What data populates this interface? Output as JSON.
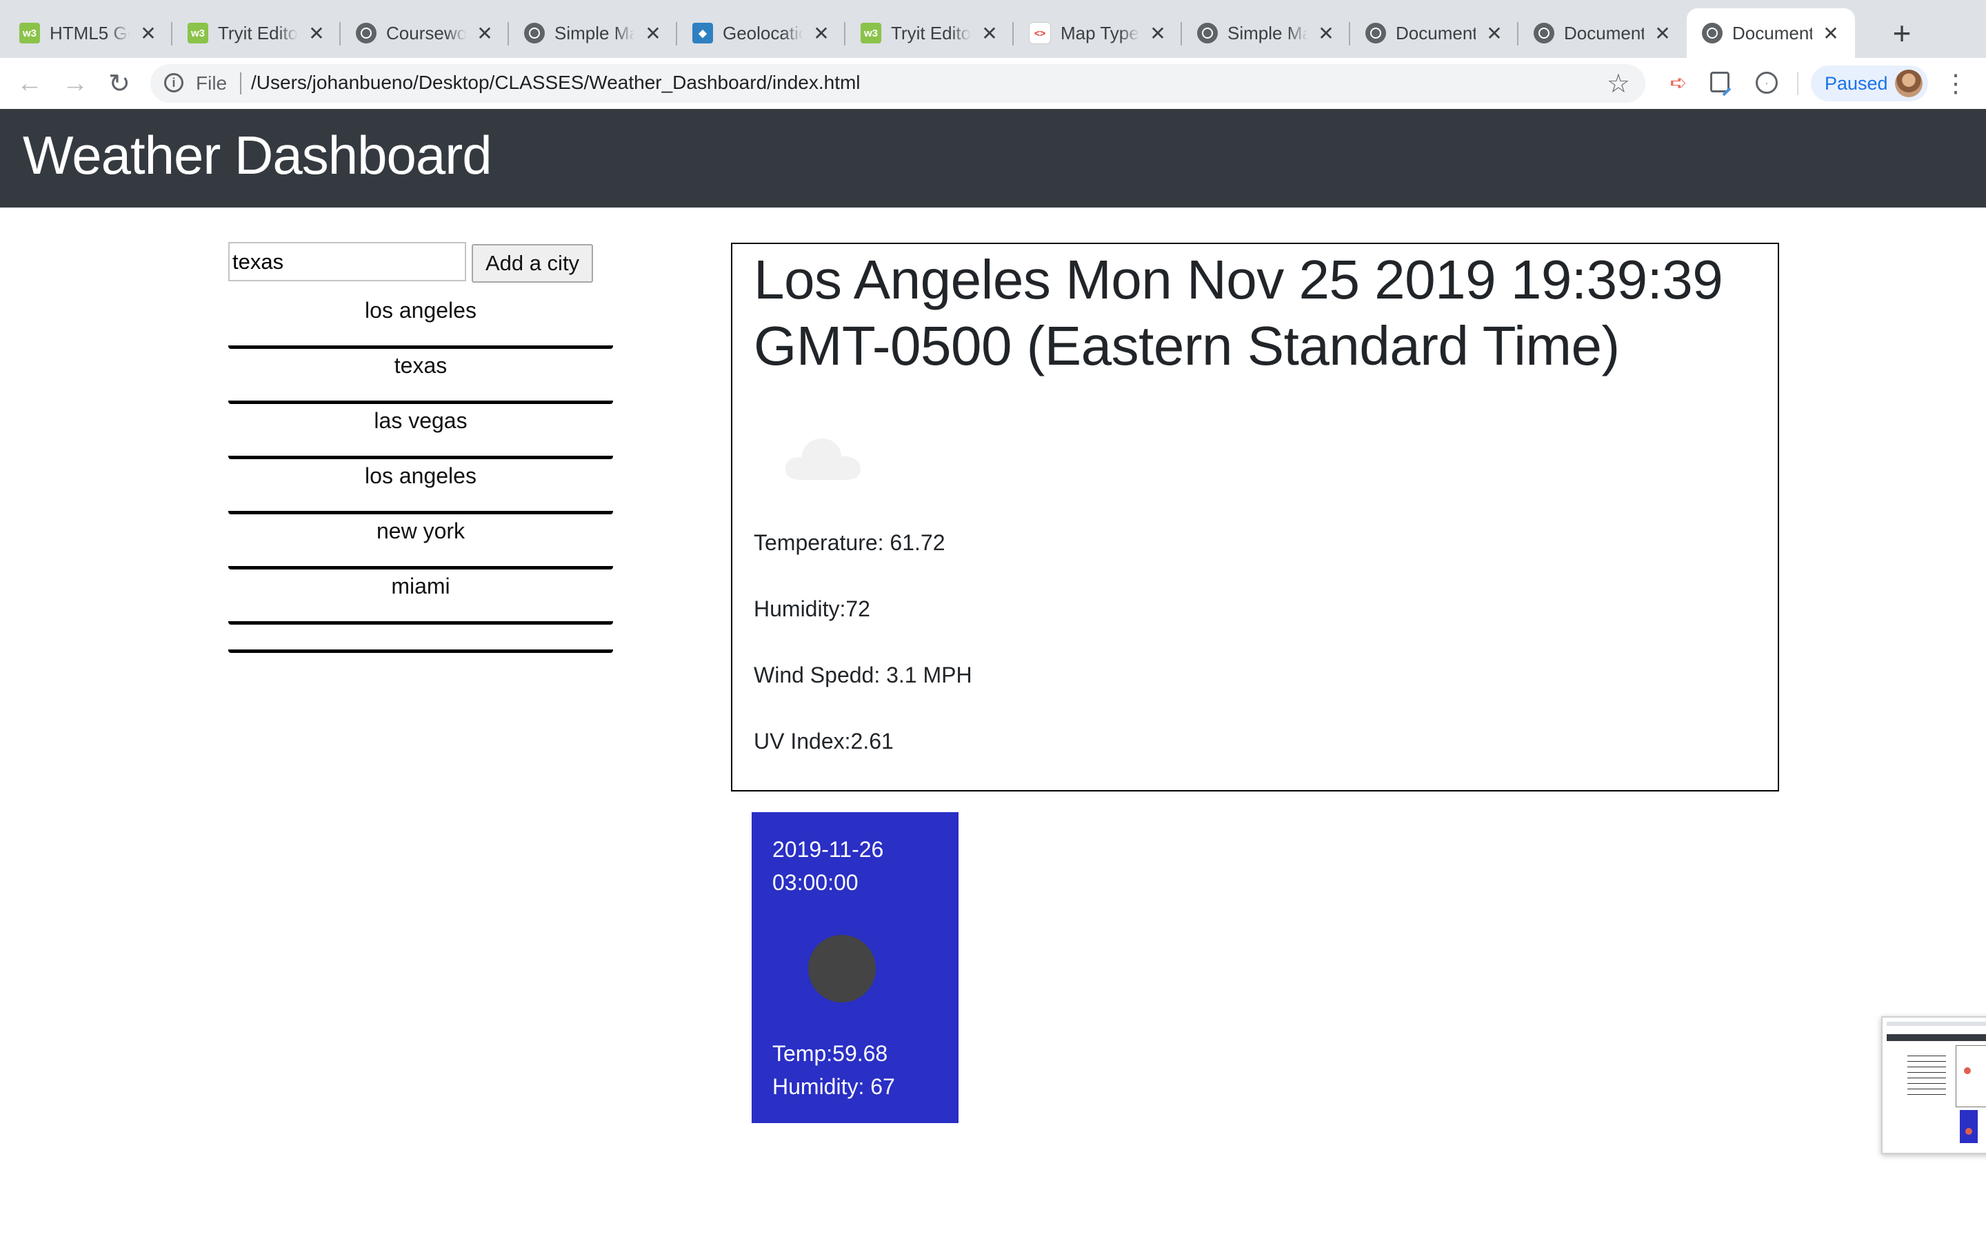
{
  "browser": {
    "tabs": [
      {
        "title": "HTML5 Ge",
        "favicon": "w3schools-icon"
      },
      {
        "title": "Tryit Edito",
        "favicon": "w3schools-icon"
      },
      {
        "title": "Coursewo",
        "favicon": "globe-icon"
      },
      {
        "title": "Simple Ma",
        "favicon": "globe-icon"
      },
      {
        "title": "Geolocatio",
        "favicon": "geolocation-icon"
      },
      {
        "title": "Tryit Edito",
        "favicon": "w3schools-icon"
      },
      {
        "title": "Map Type",
        "favicon": "maps-icon"
      },
      {
        "title": "Simple Ma",
        "favicon": "globe-icon"
      },
      {
        "title": "Document",
        "favicon": "globe-icon"
      },
      {
        "title": "Document",
        "favicon": "globe-icon"
      },
      {
        "title": "Document",
        "favicon": "globe-icon",
        "active": true
      }
    ],
    "address": {
      "scheme": "File",
      "url": "/Users/johanbueno/Desktop/CLASSES/Weather_Dashboard/index.html"
    },
    "profile_status": "Paused"
  },
  "page": {
    "title": "Weather Dashboard",
    "search": {
      "value": "texas",
      "button": "Add a city"
    },
    "cities": [
      "los angeles",
      "texas",
      "las vegas",
      "los angeles",
      "new york",
      "miami",
      ""
    ],
    "current": {
      "heading": "Los Angeles Mon Nov 25 2019 19:39:39 GMT-0500 (Eastern Standard Time)",
      "icon": "cloud-icon",
      "temperature": "Temperature: 61.72",
      "humidity": "Humidity:72",
      "wind": "Wind Spedd: 3.1 MPH",
      "uv": "UV Index:2.61"
    },
    "forecast": [
      {
        "date": "2019-11-26",
        "time": "03:00:00",
        "temp": "Temp:59.68",
        "humidity": "Humidity: 67"
      }
    ]
  },
  "colors": {
    "header_bg": "#343a40",
    "forecast_bg": "#2a2fc5",
    "paused_pill": "#e8f0fe",
    "paused_text": "#1a73e8"
  }
}
